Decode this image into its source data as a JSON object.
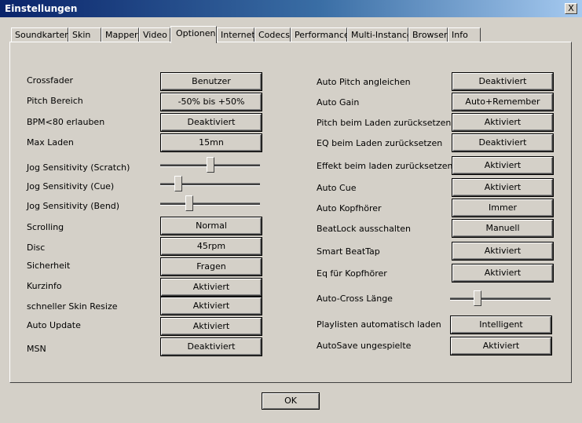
{
  "window": {
    "title": "Einstellungen",
    "close_glyph": "X"
  },
  "tabs": [
    {
      "label": "Soundkarten",
      "active": false
    },
    {
      "label": "Skin",
      "active": false
    },
    {
      "label": "Mapper",
      "active": false
    },
    {
      "label": "Video",
      "active": false
    },
    {
      "label": "Optionen",
      "active": true
    },
    {
      "label": "Internet",
      "active": false
    },
    {
      "label": "Codecs",
      "active": false
    },
    {
      "label": "Performance",
      "active": false
    },
    {
      "label": "Multi-Instance",
      "active": false
    },
    {
      "label": "Browser",
      "active": false
    },
    {
      "label": "Info",
      "active": false
    }
  ],
  "left": {
    "crossfader": {
      "label": "Crossfader",
      "value": "Benutzer"
    },
    "pitch_range": {
      "label": "Pitch Bereich",
      "value": "-50% bis +50%"
    },
    "bpm80": {
      "label": "BPM<80 erlauben",
      "value": "Deaktiviert"
    },
    "max_load": {
      "label": "Max Laden",
      "value": "15mn"
    },
    "jog_scratch": {
      "label": "Jog Sensitivity (Scratch)",
      "level": 0.5
    },
    "jog_cue": {
      "label": "Jog Sensitivity (Cue)",
      "level": 0.15
    },
    "jog_bend": {
      "label": "Jog Sensitivity (Bend)",
      "level": 0.27
    },
    "scrolling": {
      "label": "Scrolling",
      "value": "Normal"
    },
    "disc": {
      "label": "Disc",
      "value": "45rpm"
    },
    "security": {
      "label": "Sicherheit",
      "value": "Fragen"
    },
    "short_info": {
      "label": "Kurzinfo",
      "value": "Aktiviert"
    },
    "skin_resize": {
      "label": "schneller Skin Resize",
      "value": "Aktiviert"
    },
    "auto_update": {
      "label": "Auto Update",
      "value": "Aktiviert"
    },
    "msn": {
      "label": "MSN",
      "value": "Deaktiviert"
    }
  },
  "right": {
    "auto_pitch": {
      "label": "Auto Pitch angleichen",
      "value": "Deaktiviert"
    },
    "auto_gain": {
      "label": "Auto Gain",
      "value": "Auto+Remember"
    },
    "pitch_reset": {
      "label": "Pitch beim Laden zurücksetzen",
      "value": "Aktiviert"
    },
    "eq_reset": {
      "label": "EQ beim Laden zurücksetzen",
      "value": "Deaktiviert"
    },
    "effect_reset": {
      "label": "Effekt beim laden zurücksetzen",
      "value": "Aktiviert"
    },
    "auto_cue": {
      "label": "Auto Cue",
      "value": "Aktiviert"
    },
    "auto_headphones": {
      "label": "Auto Kopfhörer",
      "value": "Immer"
    },
    "beatlock": {
      "label": "BeatLock ausschalten",
      "value": "Manuell"
    },
    "smart_beattap": {
      "label": "Smart BeatTap",
      "value": "Aktiviert"
    },
    "eq_headphones": {
      "label": "Eq für Kopfhörer",
      "value": "Aktiviert"
    },
    "autocross": {
      "label": "Auto-Cross Länge",
      "level": 0.25
    },
    "playlists": {
      "label": "Playlisten automatisch laden",
      "value": "Intelligent"
    },
    "autosave": {
      "label": "AutoSave ungespielte",
      "value": "Aktiviert"
    }
  },
  "footer": {
    "ok_label": "OK"
  },
  "colors": {
    "face": "#d4d0c8",
    "title_start": "#0a246a",
    "title_end": "#a6caf0"
  }
}
